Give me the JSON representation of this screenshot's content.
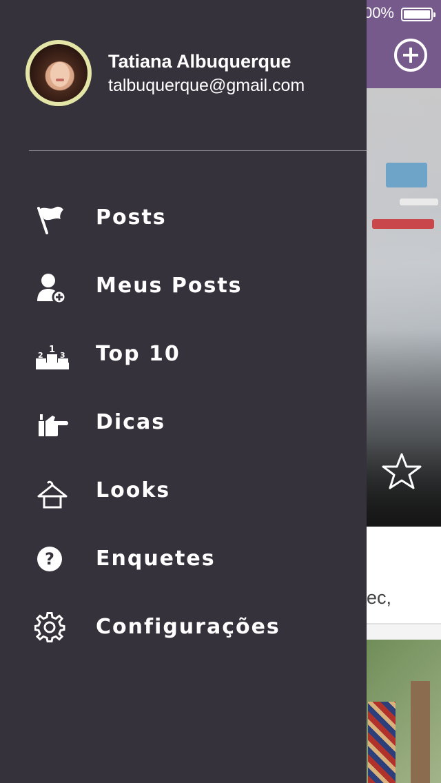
{
  "status_bar": {
    "battery_text": "00%"
  },
  "background_card": {
    "snippet": "ec,"
  },
  "profile": {
    "name": "Tatiana Albuquerque",
    "email": "talbuquerque@gmail.com"
  },
  "menu": {
    "items": [
      {
        "label": "Posts",
        "icon": "flag-icon"
      },
      {
        "label": "Meus Posts",
        "icon": "user-add-icon"
      },
      {
        "label": "Top 10",
        "icon": "podium-icon"
      },
      {
        "label": "Dicas",
        "icon": "pointing-hand-icon"
      },
      {
        "label": "Looks",
        "icon": "hanger-icon"
      },
      {
        "label": "Enquetes",
        "icon": "question-icon"
      },
      {
        "label": "Configurações",
        "icon": "gear-icon"
      }
    ]
  },
  "colors": {
    "drawer_bg": "#36323b",
    "nav_bar": "#775a8c",
    "avatar_ring": "#e3e6a6",
    "text": "#ffffff"
  }
}
